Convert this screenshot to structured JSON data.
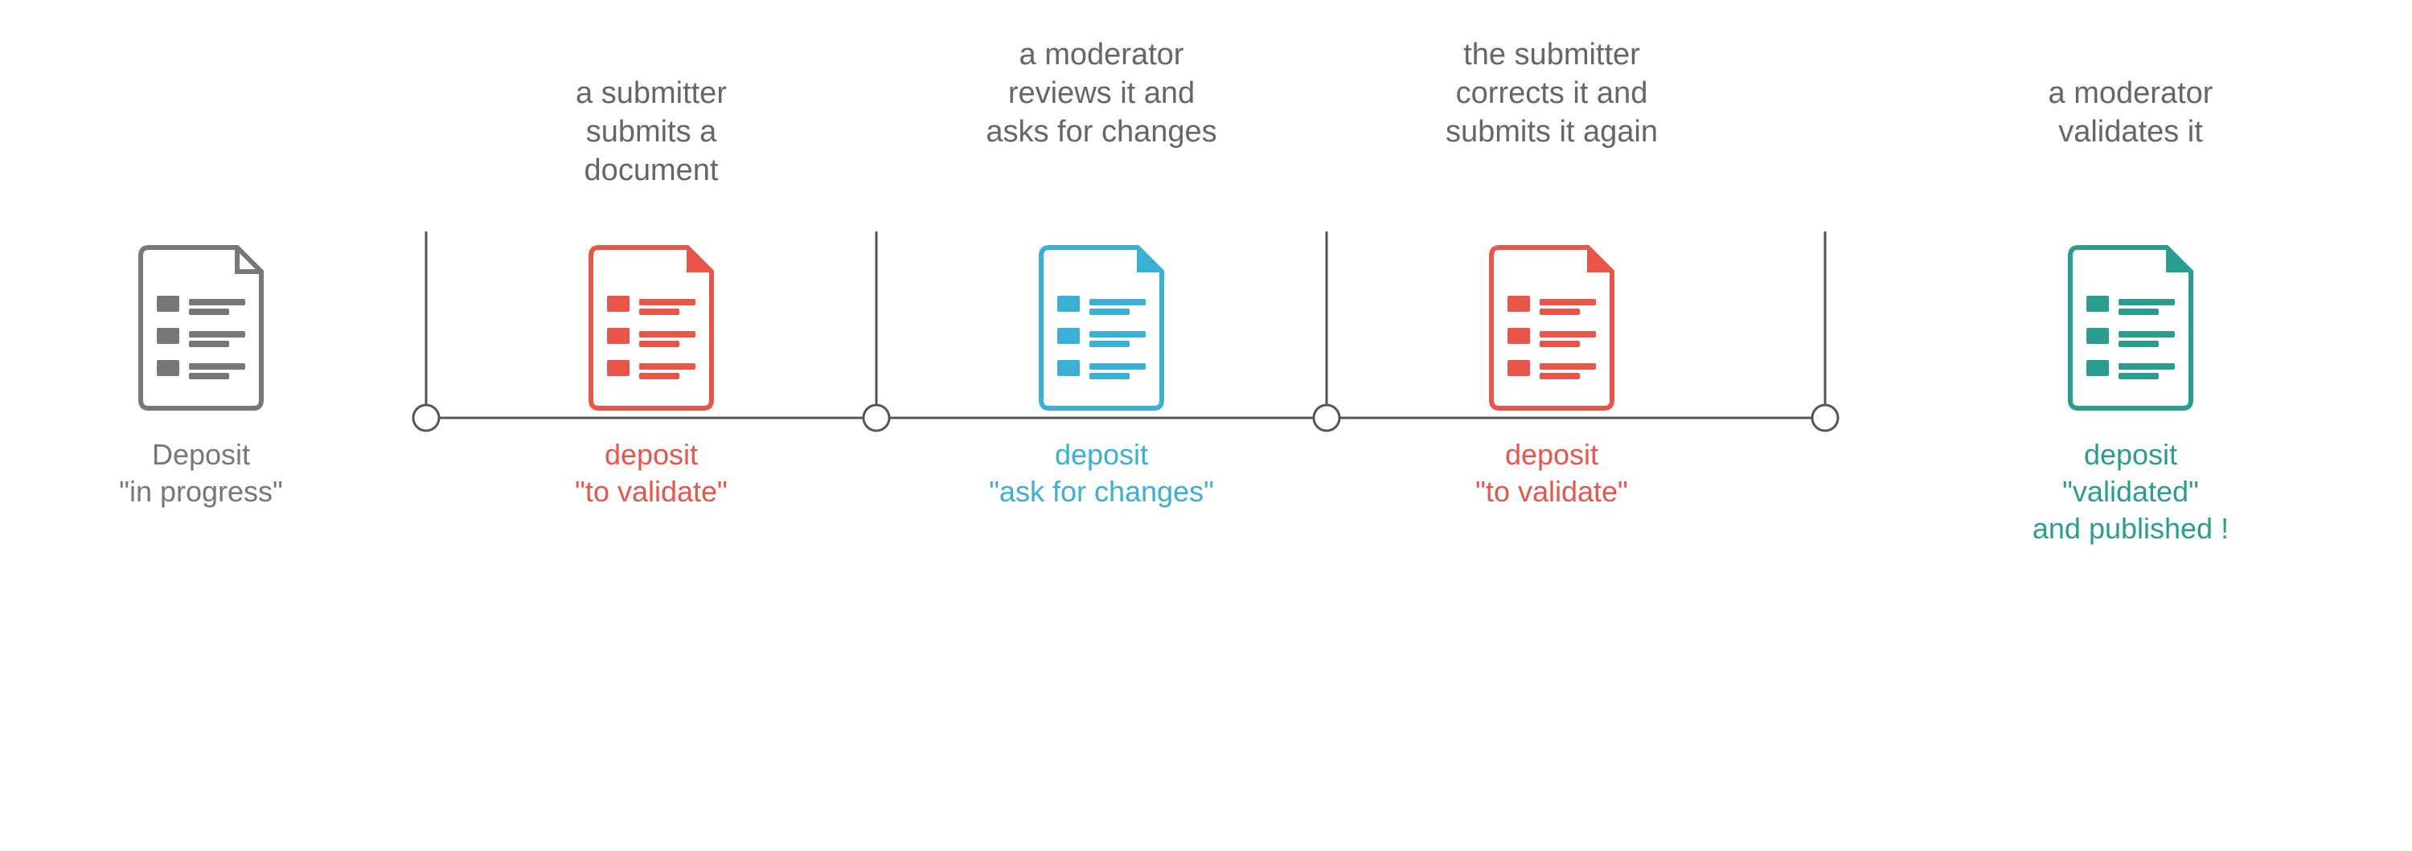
{
  "steps": [
    {
      "id": "step1",
      "top_label": "",
      "icon_color": "gray",
      "bottom_label_lines": [
        "Deposit",
        "\"in progress\""
      ],
      "bottom_label_color": "gray"
    },
    {
      "id": "step2",
      "top_label": "a submitter\nsubmits a\ndocument",
      "icon_color": "red",
      "bottom_label_lines": [
        "deposit",
        "\"to validate\""
      ],
      "bottom_label_color": "red"
    },
    {
      "id": "step3",
      "top_label": "a moderator\nreviews it and\nasks for changes",
      "icon_color": "blue",
      "bottom_label_lines": [
        "deposit",
        "\"ask for changes\""
      ],
      "bottom_label_color": "blue"
    },
    {
      "id": "step4",
      "top_label": "the submitter\ncorrects it and\nsubmits it again",
      "icon_color": "red",
      "bottom_label_lines": [
        "deposit",
        "\"to validate\""
      ],
      "bottom_label_color": "red"
    },
    {
      "id": "step5",
      "top_label": "a moderator\nvalidates it",
      "icon_color": "teal",
      "bottom_label_lines": [
        "deposit",
        "\"validated\"",
        "and published !"
      ],
      "bottom_label_color": "teal"
    }
  ],
  "colors": {
    "gray": "#777777",
    "red": "#e8564a",
    "blue": "#3ab0d4",
    "teal": "#2a9d8f",
    "line": "#555555"
  }
}
